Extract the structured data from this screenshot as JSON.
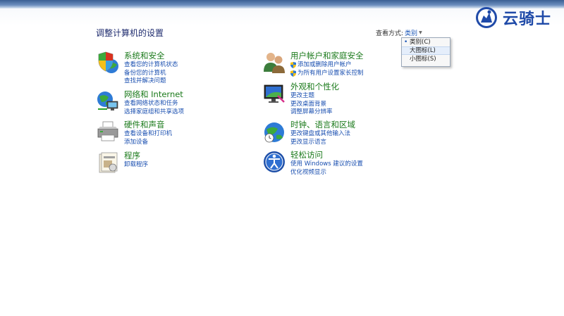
{
  "header": {
    "title": "调整计算机的设置"
  },
  "view_by": {
    "label": "查看方式:",
    "value": "类别",
    "options": [
      "类别(C)",
      "大图标(L)",
      "小图标(S)"
    ]
  },
  "watermark": {
    "text": "云骑士"
  },
  "left_categories": [
    {
      "title": "系统和安全",
      "icon": "shield-globe-icon",
      "links": [
        "查看您的计算机状态",
        "备份您的计算机",
        "查找并解决问题"
      ]
    },
    {
      "title": "网络和 Internet",
      "icon": "network-globe-icon",
      "links": [
        "查看网络状态和任务",
        "选择家庭组和共享选项"
      ]
    },
    {
      "title": "硬件和声音",
      "icon": "printer-icon",
      "links": [
        "查看设备和打印机",
        "添加设备"
      ]
    },
    {
      "title": "程序",
      "icon": "programs-icon",
      "links": [
        "卸载程序"
      ]
    }
  ],
  "right_categories": [
    {
      "title": "用户帐户和家庭安全",
      "icon": "users-icon",
      "links": [
        "添加或删除用户帐户",
        "为所有用户设置家长控制"
      ]
    },
    {
      "title": "外观和个性化",
      "icon": "monitor-icon",
      "links": [
        "更改主题",
        "更改桌面背景",
        "调整屏幕分辨率"
      ]
    },
    {
      "title": "时钟、语言和区域",
      "icon": "clock-globe-icon",
      "links": [
        "更改键盘或其他输入法",
        "更改显示语言"
      ]
    },
    {
      "title": "轻松访问",
      "icon": "accessibility-icon",
      "links": [
        "使用 Windows 建议的设置",
        "优化视频显示"
      ]
    }
  ],
  "colors": {
    "category_title": "#1b7a1b",
    "link": "#1a4fb0",
    "accent": "#1f4aa8"
  }
}
